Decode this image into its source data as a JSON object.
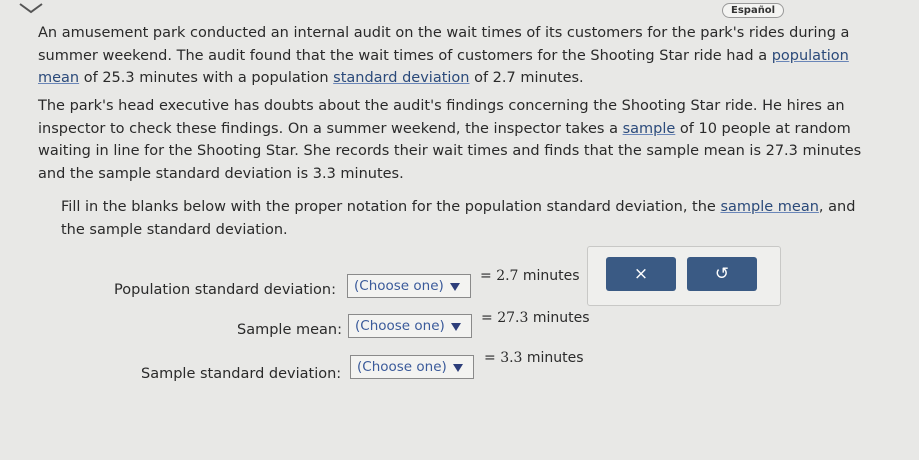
{
  "header": {
    "language_button": "Español"
  },
  "problem": {
    "p1_a": "An amusement park conducted an internal audit on the wait times of its customers for the park's rides during a summer weekend. The audit found that the wait times of customers for the Shooting Star ride had a ",
    "p1_link1": "population mean",
    "p1_b": " of 25.3 minutes with a population ",
    "p1_link2": "standard deviation",
    "p1_c": " of 2.7 minutes.",
    "p2_a": "The park's head executive has doubts about the audit's findings concerning the Shooting Star ride. He hires an inspector to check these findings. On a summer weekend, the inspector takes a ",
    "p2_link": "sample",
    "p2_b": " of 10 people at random waiting in line for the Shooting Star. She records their wait times and finds that the sample mean is 27.3 minutes and the sample standard deviation is 3.3 minutes.",
    "p3_a": "Fill in the blanks below with the proper notation for the population standard deviation, the ",
    "p3_link": "sample mean",
    "p3_b": ", and the sample standard deviation."
  },
  "rows": [
    {
      "label": "Population standard deviation:",
      "select": "(Choose one)",
      "eq": "=",
      "value": "2.7",
      "unit": "minutes"
    },
    {
      "label": "Sample mean:",
      "select": "(Choose one)",
      "eq": "=",
      "value": "27.3",
      "unit": "minutes"
    },
    {
      "label": "Sample standard deviation:",
      "select": "(Choose one)",
      "eq": "=",
      "value": "3.3",
      "unit": "minutes"
    }
  ],
  "toolbar": {
    "clear_symbol": "×",
    "undo_symbol": "↺"
  },
  "icons": [
    "chevron-down-icon",
    "dropdown-arrow-icon",
    "close-icon",
    "undo-icon"
  ]
}
